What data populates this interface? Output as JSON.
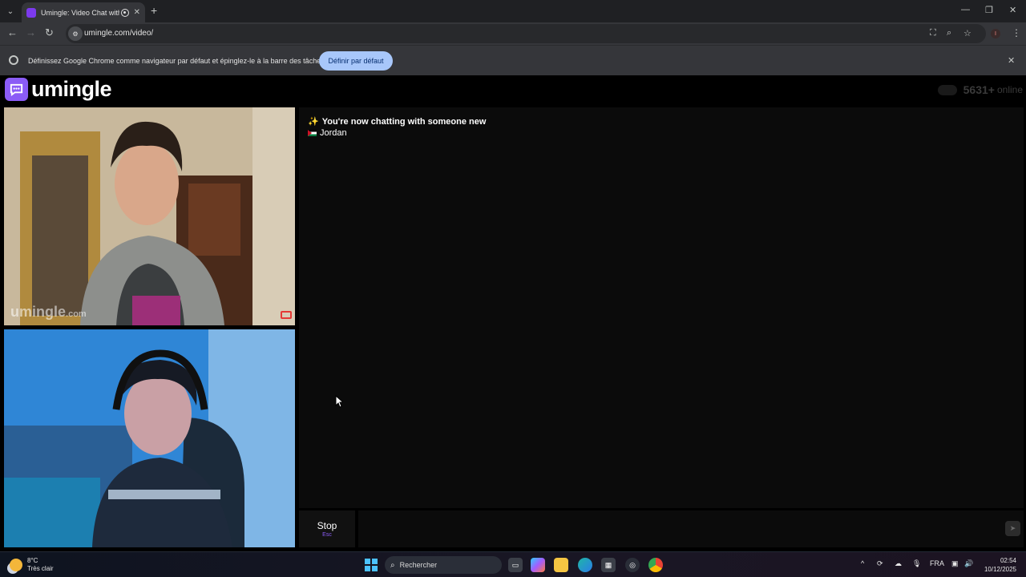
{
  "browser": {
    "tab": {
      "title": "Umingle: Video Chat with S",
      "favicon": "umingle-favicon-icon"
    },
    "new_tab": "+",
    "window_controls": {
      "minimize": "—",
      "restore": "❐",
      "close": "✕"
    },
    "url": "umingle.com/video/",
    "nav": {
      "back": "←",
      "forward": "→",
      "reload": "↻"
    },
    "toolbar_icons": {
      "translate": "⛶",
      "zoom": "⌕",
      "bookmark": "☆"
    },
    "profile_letter": "I",
    "menu": "⋮"
  },
  "infobar": {
    "text": "Définissez Google Chrome comme navigateur par défaut et épinglez-le à la barre des tâches",
    "button": "Définir par défaut",
    "close": "✕"
  },
  "site": {
    "logo_text": "umingle",
    "online_count": "5631+",
    "online_label": "online",
    "watermark": "umingle",
    "watermark_suffix": ".com"
  },
  "chat": {
    "system_message": "You're now chatting with someone new",
    "partner_country": "Jordan",
    "sparkle": "✨"
  },
  "controls": {
    "stop_label": "Stop",
    "stop_key": "Esc",
    "message_placeholder": "",
    "send": "➤"
  },
  "taskbar": {
    "weather_temp": "8°C",
    "weather_desc": "Très clair",
    "search_label": "Rechercher",
    "search_glyph": "⌕",
    "language": "FRA",
    "time": "02:54",
    "date": "10/12/2025",
    "tray": {
      "chevron": "^",
      "mic": "🎙",
      "speaker": "🔊"
    }
  },
  "colors": {
    "accent": "#8b5cf6",
    "chrome_button": "#a8c7fa",
    "report_red": "#e53935"
  }
}
